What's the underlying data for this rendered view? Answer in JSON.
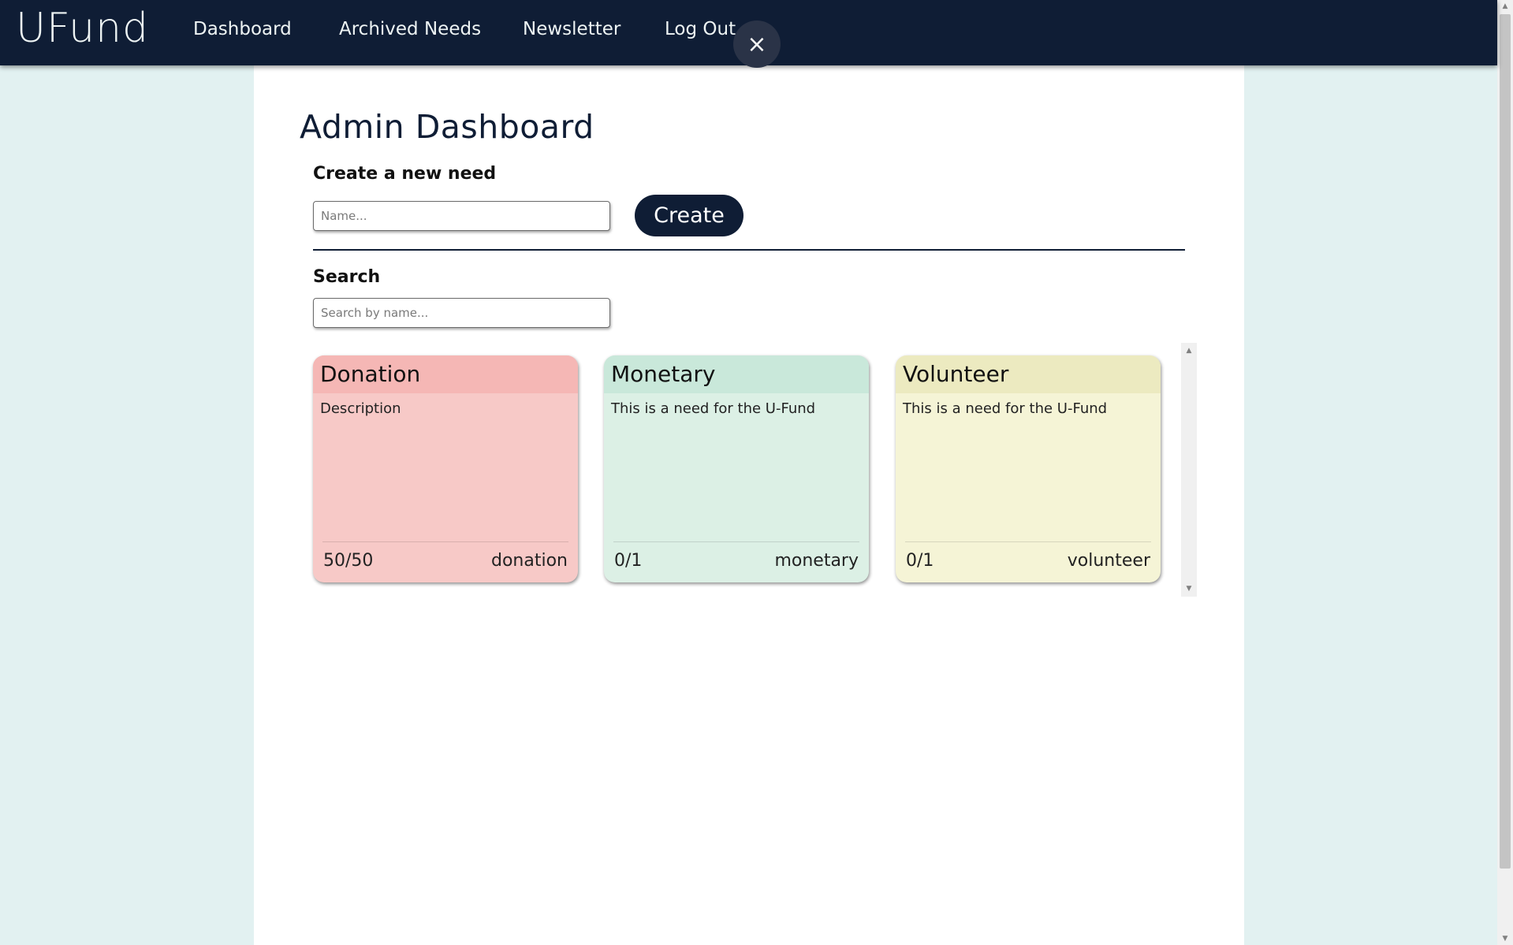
{
  "header": {
    "brand": "UFund",
    "nav": [
      {
        "label": "Dashboard"
      },
      {
        "label": "Archived Needs"
      },
      {
        "label": "Newsletter"
      },
      {
        "label": "Log Out"
      }
    ],
    "close_glyph": "×"
  },
  "main": {
    "title": "Admin Dashboard",
    "create": {
      "label": "Create a new need",
      "name_placeholder": "Name...",
      "button_label": "Create"
    },
    "search": {
      "label": "Search",
      "placeholder": "Search by name..."
    },
    "needs": [
      {
        "name": "Donation",
        "description": "Description",
        "progress": "50/50",
        "type": "donation",
        "header_color": "#f5b7b5",
        "body_color": "#f7c9c7"
      },
      {
        "name": "Monetary",
        "description": "This is a need for the U-Fund",
        "progress": "0/1",
        "type": "monetary",
        "header_color": "#c9e8da",
        "body_color": "#dcf0e5"
      },
      {
        "name": "Volunteer",
        "description": "This is a need for the U-Fund",
        "progress": "0/1",
        "type": "volunteer",
        "header_color": "#eceac0",
        "body_color": "#f5f4d6"
      }
    ]
  },
  "colors": {
    "navy": "#0f1d35",
    "page_background": "#e2f1f1",
    "panel_background": "#ffffff"
  }
}
